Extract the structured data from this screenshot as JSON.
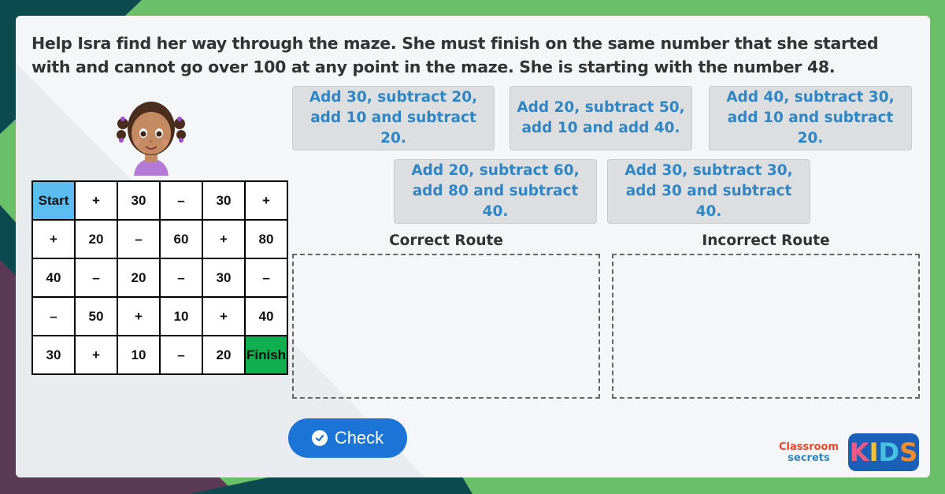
{
  "colors": {
    "accent_blue": "#2f86c4",
    "check_button": "#1b74d6",
    "start_cell": "#5bbcf0",
    "finish_cell": "#0fae4f",
    "background_green": "#6bbf68",
    "background_dark_teal": "#0c4a4f",
    "background_plum": "#5a3a55"
  },
  "question": "Help Isra find her way through the maze. She must finish on the same number that she started with and cannot go over 100 at any point in the maze. She is starting with the number 48.",
  "maze": {
    "rows": [
      [
        "Start",
        "+",
        "30",
        "–",
        "30",
        "+"
      ],
      [
        "+",
        "20",
        "–",
        "60",
        "+",
        "80"
      ],
      [
        "40",
        "–",
        "20",
        "–",
        "30",
        "–"
      ],
      [
        "–",
        "50",
        "+",
        "10",
        "+",
        "40"
      ],
      [
        "30",
        "+",
        "10",
        "–",
        "20",
        "Finish"
      ]
    ]
  },
  "cards": [
    "Add 30, subtract 20, add 10 and subtract 20.",
    "Add 20, subtract 50, add 10 and add 40.",
    "Add 40, subtract 30, add 10 and subtract 20.",
    "Add 20, subtract 60, add 80 and subtract 40.",
    "Add 30, subtract 30, add 30 and subtract 40."
  ],
  "zones": {
    "correct_label": "Correct Route",
    "incorrect_label": "Incorrect Route"
  },
  "check_button": {
    "label": "Check",
    "icon": "check-circle-icon"
  },
  "logo": {
    "line1": "Classroom",
    "line2": "secrets",
    "kids": [
      "K",
      "I",
      "D",
      "S"
    ],
    "kids_colors": [
      "#f05a7e",
      "#f7c12d",
      "#46c2e0",
      "#f38d2a"
    ]
  }
}
